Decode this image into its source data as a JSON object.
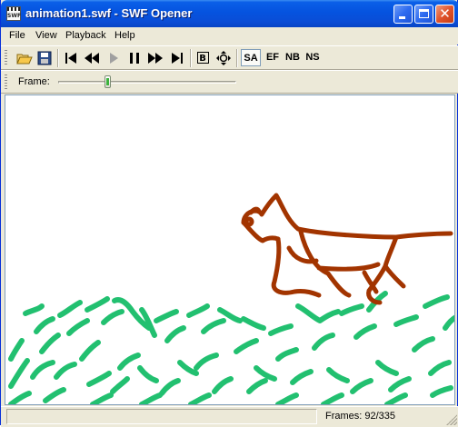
{
  "window": {
    "title": "animation1.swf - SWF Opener",
    "app_icon_text": "SWF"
  },
  "menu": [
    "File",
    "View",
    "Playback",
    "Help"
  ],
  "toolbar": {
    "buttons": [
      {
        "name": "open-icon",
        "glyph": "📂"
      },
      {
        "name": "save-icon",
        "glyph": "💾"
      },
      {
        "name": "first-frame-icon",
        "glyph": "⏮"
      },
      {
        "name": "rewind-icon",
        "glyph": "⏪"
      },
      {
        "name": "play-icon",
        "glyph": "▶",
        "disabled": true
      },
      {
        "name": "pause-icon",
        "glyph": "⏸"
      },
      {
        "name": "fast-forward-icon",
        "glyph": "⏩"
      },
      {
        "name": "last-frame-icon",
        "glyph": "⏭"
      },
      {
        "name": "border-icon",
        "glyph": "B"
      },
      {
        "name": "fit-icon",
        "glyph": "✥"
      }
    ],
    "scale_buttons": [
      "SA",
      "EF",
      "NB",
      "NS"
    ],
    "scale_active": "SA"
  },
  "frame_bar": {
    "label": "Frame:",
    "current": 92,
    "total": 335
  },
  "status": {
    "frames_text": "Frames: 92/335"
  },
  "colors": {
    "animal_stroke": "#a23400",
    "grass": "#22c070",
    "title_bar": "#0a5fe8"
  }
}
